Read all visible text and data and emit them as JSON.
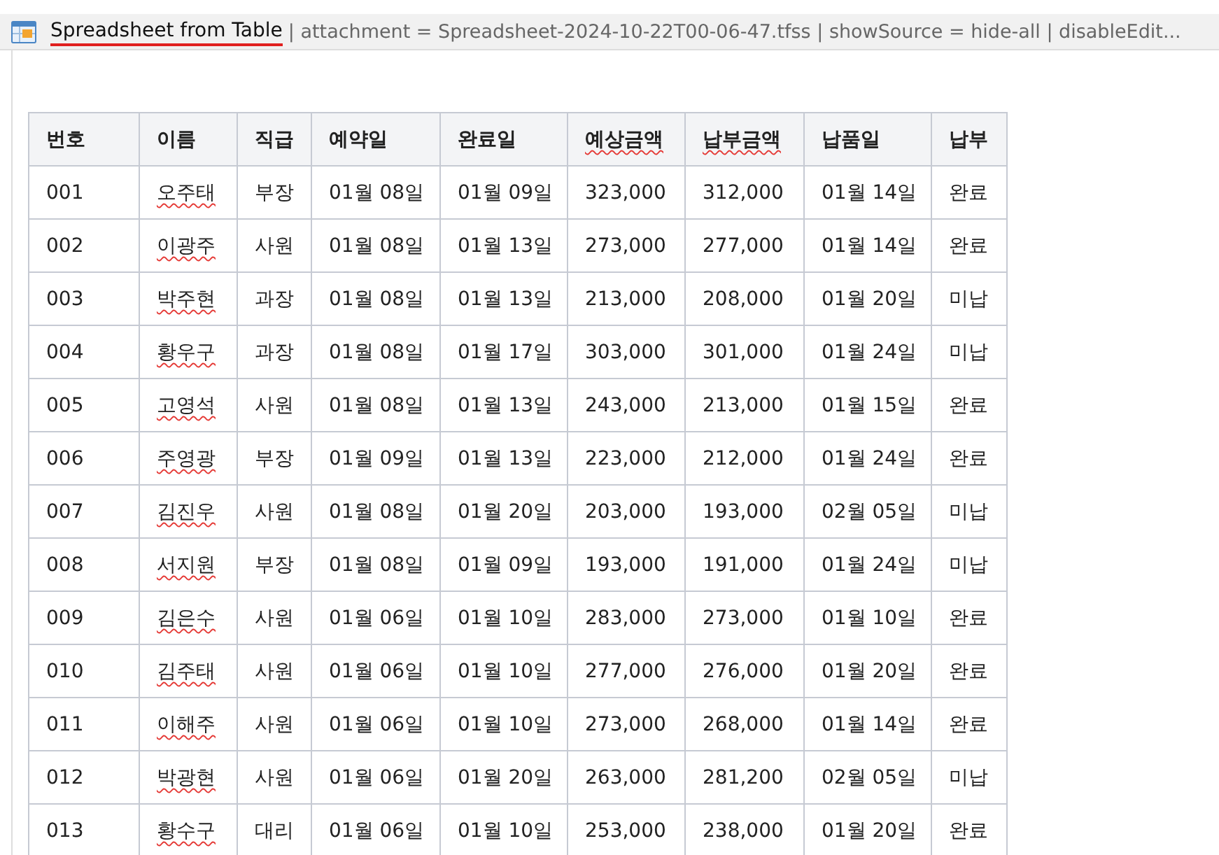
{
  "header": {
    "title": "Spreadsheet from Table",
    "details": "| attachment = Spreadsheet-2024-10-22T00-06-47.tfss | showSource = hide-all | disableEdit..."
  },
  "table": {
    "columns": [
      {
        "label": "번호",
        "misspelled": false,
        "cells_misspelled": false
      },
      {
        "label": "이름",
        "misspelled": false,
        "cells_misspelled": true
      },
      {
        "label": "직급",
        "misspelled": false,
        "cells_misspelled": false
      },
      {
        "label": "예약일",
        "misspelled": false,
        "cells_misspelled": false
      },
      {
        "label": "완료일",
        "misspelled": false,
        "cells_misspelled": false
      },
      {
        "label": "예상금액",
        "misspelled": true,
        "cells_misspelled": false
      },
      {
        "label": "납부금액",
        "misspelled": true,
        "cells_misspelled": false
      },
      {
        "label": "납품일",
        "misspelled": false,
        "cells_misspelled": false
      },
      {
        "label": "납부",
        "misspelled": false,
        "cells_misspelled": false
      }
    ],
    "rows": [
      [
        "001",
        "오주태",
        "부장",
        "01월 08일",
        "01월 09일",
        "323,000",
        "312,000",
        "01월 14일",
        "완료"
      ],
      [
        "002",
        "이광주",
        "사원",
        "01월 08일",
        "01월 13일",
        "273,000",
        "277,000",
        "01월 14일",
        "완료"
      ],
      [
        "003",
        "박주현",
        "과장",
        "01월 08일",
        "01월 13일",
        "213,000",
        "208,000",
        "01월 20일",
        "미납"
      ],
      [
        "004",
        "황우구",
        "과장",
        "01월 08일",
        "01월 17일",
        "303,000",
        "301,000",
        "01월 24일",
        "미납"
      ],
      [
        "005",
        "고영석",
        "사원",
        "01월 08일",
        "01월 13일",
        "243,000",
        "213,000",
        "01월 15일",
        "완료"
      ],
      [
        "006",
        "주영광",
        "부장",
        "01월 09일",
        "01월 13일",
        "223,000",
        "212,000",
        "01월 24일",
        "완료"
      ],
      [
        "007",
        "김진우",
        "사원",
        "01월 08일",
        "01월 20일",
        "203,000",
        "193,000",
        "02월 05일",
        "미납"
      ],
      [
        "008",
        "서지원",
        "부장",
        "01월 08일",
        "01월 09일",
        "193,000",
        "191,000",
        "01월 24일",
        "미납"
      ],
      [
        "009",
        "김은수",
        "사원",
        "01월 06일",
        "01월 10일",
        "283,000",
        "273,000",
        "01월 10일",
        "완료"
      ],
      [
        "010",
        "김주태",
        "사원",
        "01월 06일",
        "01월 10일",
        "277,000",
        "276,000",
        "01월 20일",
        "완료"
      ],
      [
        "011",
        "이해주",
        "사원",
        "01월 06일",
        "01월 10일",
        "273,000",
        "268,000",
        "01월 14일",
        "완료"
      ],
      [
        "012",
        "박광현",
        "사원",
        "01월 06일",
        "01월 20일",
        "263,000",
        "281,200",
        "02월 05일",
        "미납"
      ],
      [
        "013",
        "황수구",
        "대리",
        "01월 06일",
        "01월 10일",
        "253,000",
        "238,000",
        "01월 20일",
        "완료"
      ]
    ]
  }
}
